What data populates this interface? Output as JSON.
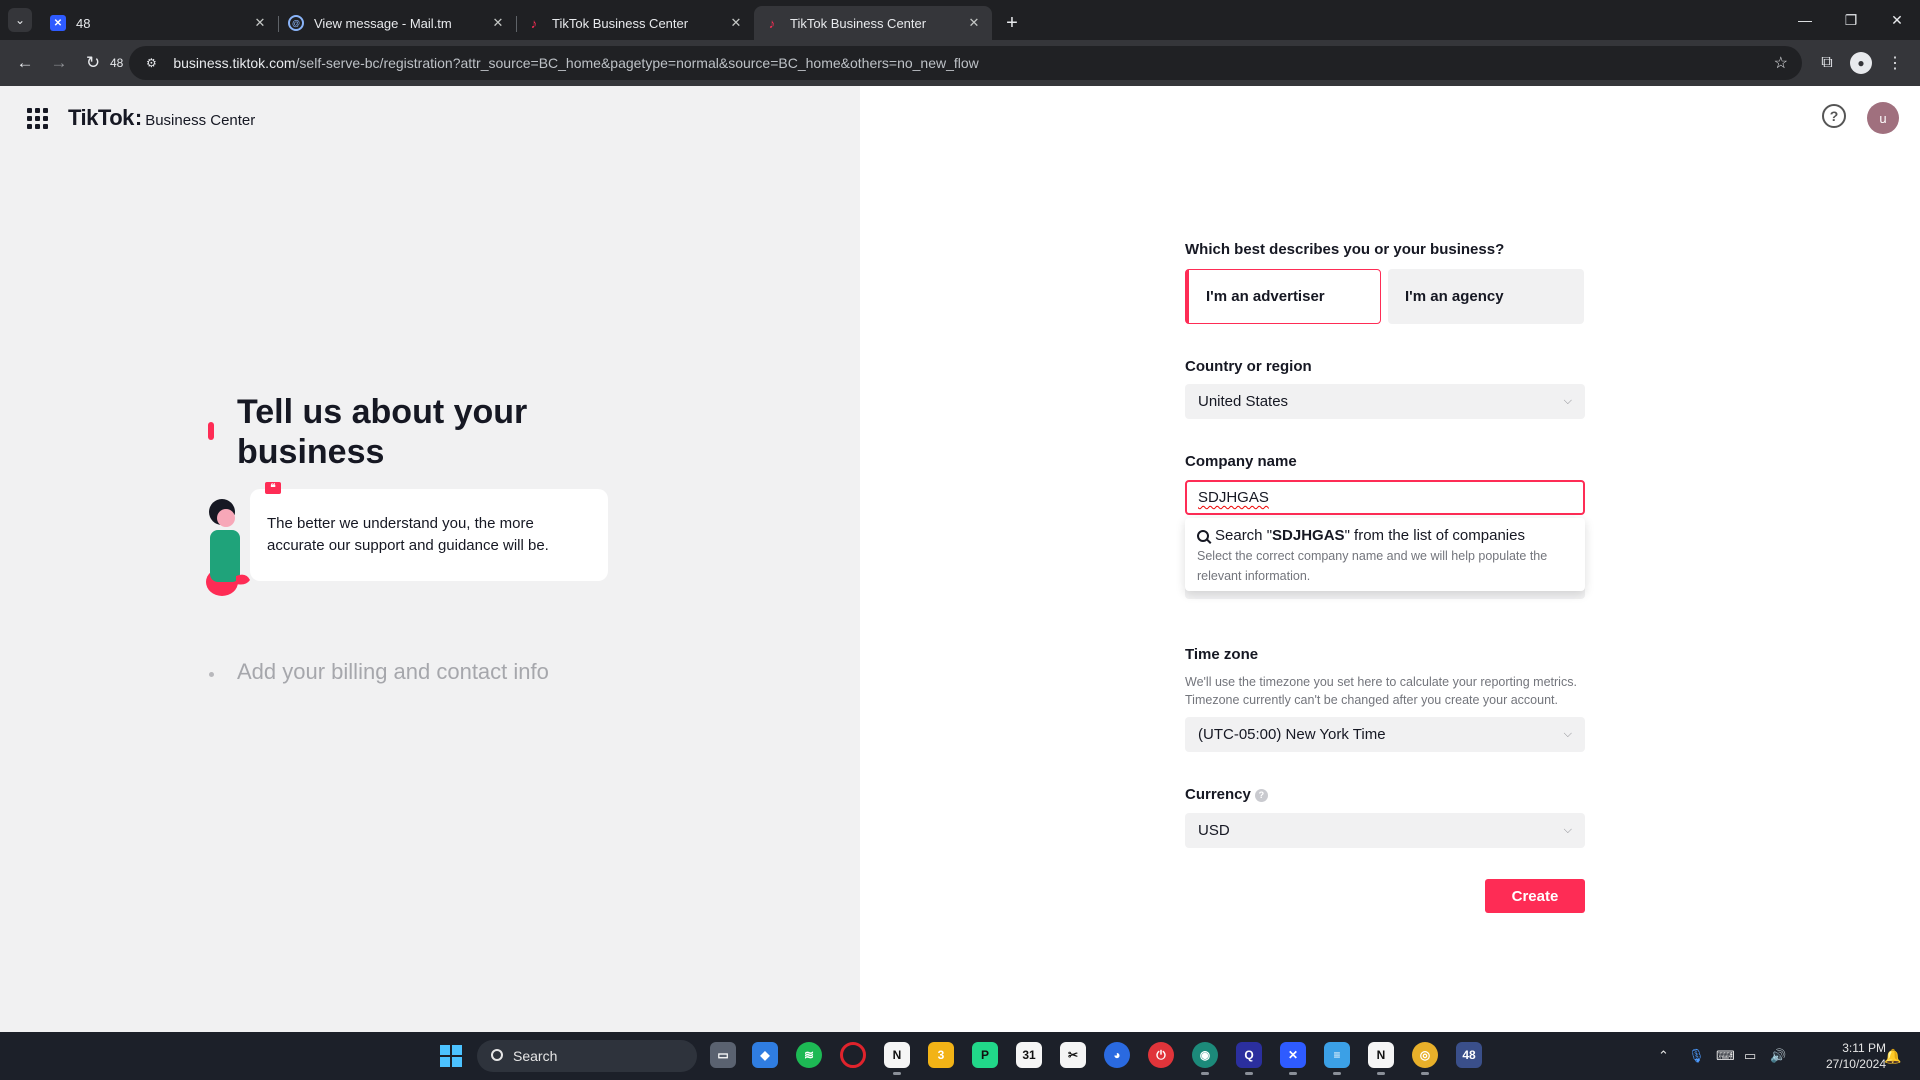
{
  "browser": {
    "tabs": [
      {
        "title": "48",
        "favicon": "x-icon",
        "active": false
      },
      {
        "title": "View message - Mail.tm",
        "favicon": "at-icon",
        "active": false
      },
      {
        "title": "TikTok Business Center",
        "favicon": "tiktok-icon",
        "active": false
      },
      {
        "title": "TikTok Business Center",
        "favicon": "tiktok-icon",
        "active": true
      }
    ],
    "new_tab": "+",
    "reload_count": "48",
    "url_host": "business.tiktok.com",
    "url_path": "/self-serve-bc/registration?attr_source=BC_home&pagetype=normal&source=BC_home&others=no_new_flow"
  },
  "header": {
    "logo": "TikTok",
    "logo_sub": "Business Center",
    "help": "?",
    "avatar": "u"
  },
  "left": {
    "step1_title": "Tell us about your business",
    "tip_text": "The better we understand you, the more accurate our support and guidance will be.",
    "step2_title": "Add your billing and contact info"
  },
  "form": {
    "business_type_label": "Which best describes you or your business?",
    "advertiser_option": "I'm an advertiser",
    "agency_option": "I'm an agency",
    "country_label": "Country or region",
    "country_value": "United States",
    "company_label": "Company name",
    "company_value": "SDJHGAS",
    "dropdown_prefix": "Search \"",
    "dropdown_query": "SDJHGAS",
    "dropdown_suffix": "\" from the list of companies",
    "dropdown_hint": "Select the correct company name and we will help populate the relevant information.",
    "partial_field_value": "SDJH",
    "timezone_label": "Time zone",
    "timezone_helper": "We'll use the timezone you set here to calculate your reporting metrics. Timezone currently can't be changed after you create your account.",
    "timezone_value": "(UTC-05:00) New York Time",
    "currency_label": "Currency",
    "currency_value": "USD",
    "create_label": "Create"
  },
  "taskbar": {
    "search_label": "Search",
    "time": "3:11 PM",
    "date": "27/10/2024",
    "apps": [
      "file-explorer-icon",
      "maps-icon",
      "spotify-icon",
      "opera-icon",
      "notion-icon",
      "files-icon",
      "pycharm-icon",
      "calendar-icon",
      "capcut-icon",
      "firefox-icon",
      "power-icon",
      "browser-icon",
      "proton-icon",
      "x-app-icon",
      "notepad-icon",
      "notion-badge-icon",
      "chrome-icon",
      "app-48-icon"
    ]
  },
  "colors": {
    "brand": "#fe2c55",
    "left_bg": "#f1f1f2",
    "chrome_dark": "#1f2023"
  }
}
